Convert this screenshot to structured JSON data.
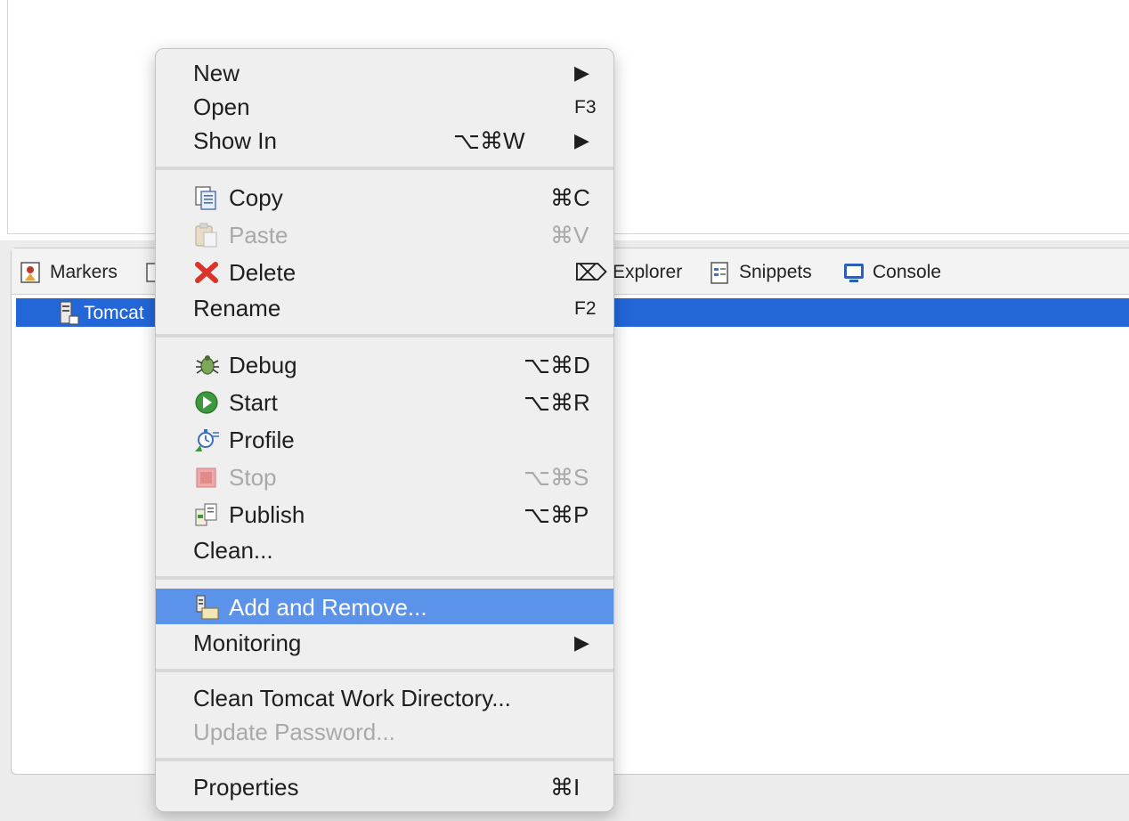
{
  "tabs": [
    {
      "label": "Markers",
      "icon": "markers-icon"
    },
    {
      "label": "Explorer",
      "icon": "data-source-explorer-icon"
    },
    {
      "label": "Snippets",
      "icon": "snippets-icon"
    },
    {
      "label": "Console",
      "icon": "console-icon"
    }
  ],
  "server": {
    "label": "Tomcat"
  },
  "menu": {
    "new": {
      "label": "New",
      "shortcut": ""
    },
    "open": {
      "label": "Open",
      "shortcut": "F3"
    },
    "show_in": {
      "label": "Show In",
      "shortcut": "⌥⌘W"
    },
    "copy": {
      "label": "Copy",
      "shortcut": "⌘C"
    },
    "paste": {
      "label": "Paste",
      "shortcut": "⌘V"
    },
    "delete": {
      "label": "Delete",
      "shortcut": "⌦"
    },
    "rename": {
      "label": "Rename",
      "shortcut": "F2"
    },
    "debug": {
      "label": "Debug",
      "shortcut": "⌥⌘D"
    },
    "start": {
      "label": "Start",
      "shortcut": "⌥⌘R"
    },
    "profile": {
      "label": "Profile",
      "shortcut": ""
    },
    "stop": {
      "label": "Stop",
      "shortcut": "⌥⌘S"
    },
    "publish": {
      "label": "Publish",
      "shortcut": "⌥⌘P"
    },
    "clean": {
      "label": "Clean...",
      "shortcut": ""
    },
    "add_remove": {
      "label": "Add and Remove...",
      "shortcut": ""
    },
    "monitoring": {
      "label": "Monitoring",
      "shortcut": ""
    },
    "clean_work_dir": {
      "label": "Clean Tomcat Work Directory...",
      "shortcut": ""
    },
    "update_password": {
      "label": "Update Password...",
      "shortcut": ""
    },
    "properties": {
      "label": "Properties",
      "shortcut": "⌘I"
    },
    "submenu_arrow": "▶"
  },
  "colors": {
    "selection": "#2266d8",
    "menu_highlight": "#5b93ea",
    "disabled_text": "#a9a9a9"
  }
}
